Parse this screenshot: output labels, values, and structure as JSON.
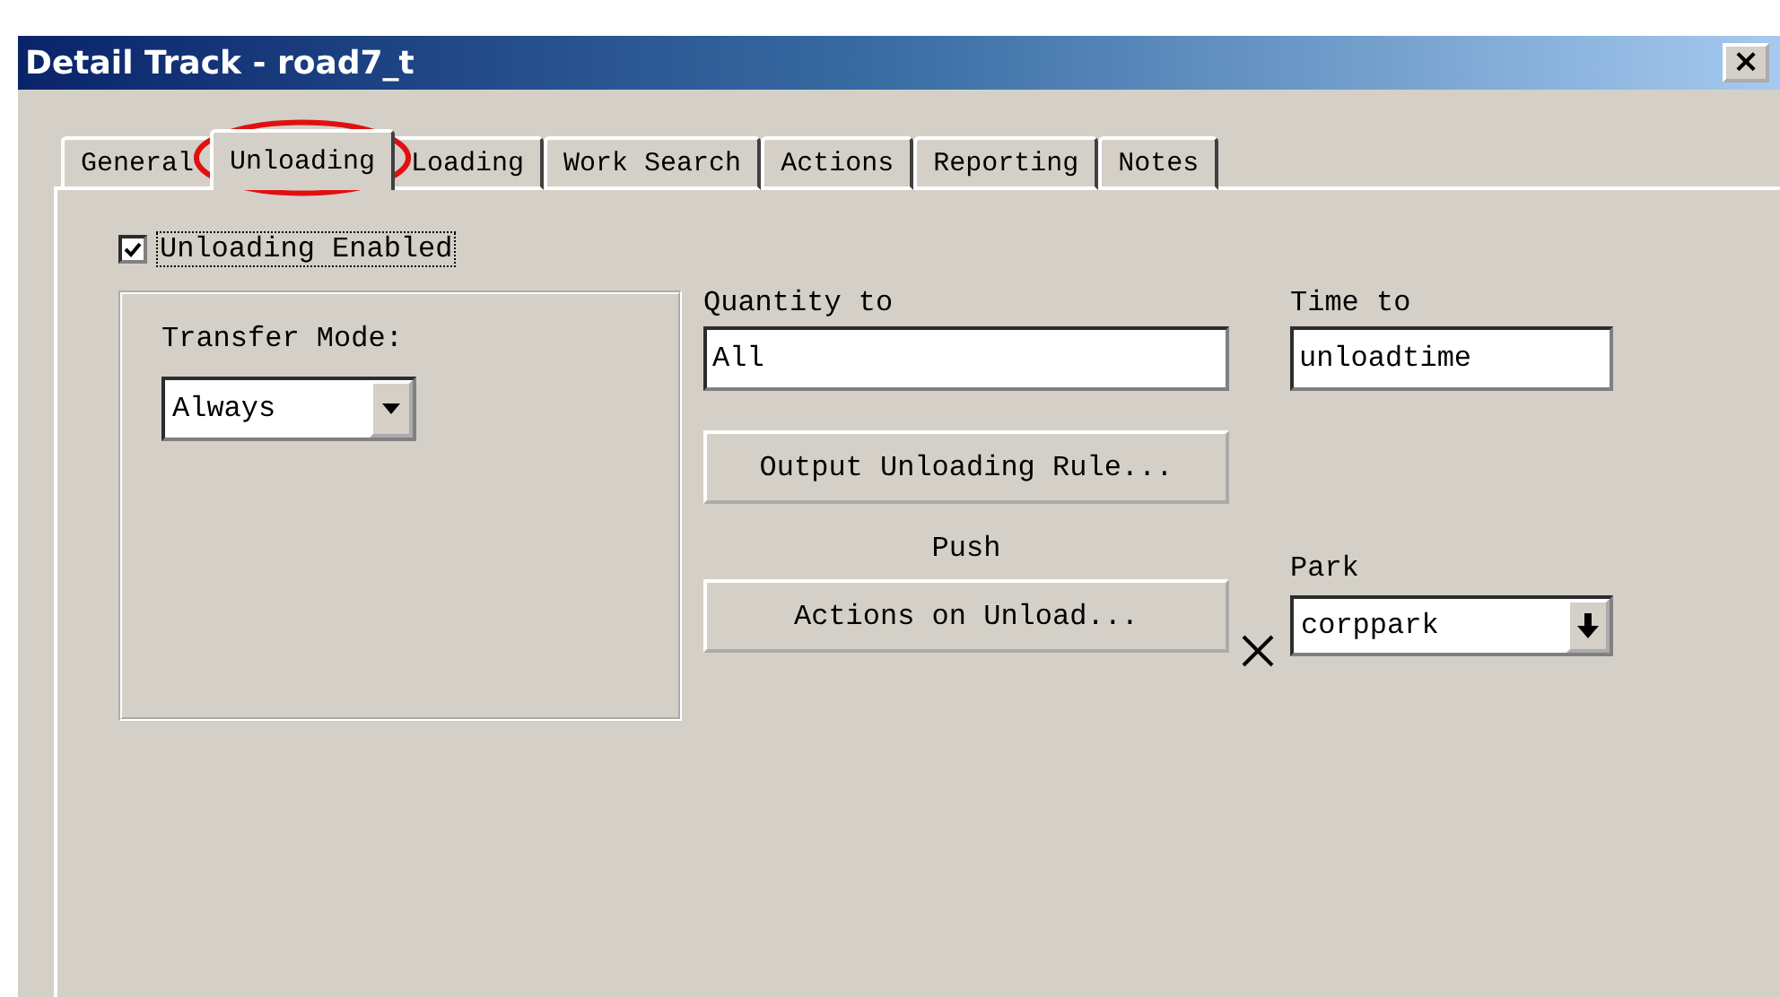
{
  "window": {
    "title": "Detail Track - road7_t",
    "close": "×"
  },
  "tabs": [
    {
      "label": "General",
      "selected": false
    },
    {
      "label": "Unloading",
      "selected": true,
      "circled": true
    },
    {
      "label": "Loading",
      "selected": false
    },
    {
      "label": "Work Search",
      "selected": false
    },
    {
      "label": "Actions",
      "selected": false
    },
    {
      "label": "Reporting",
      "selected": false
    },
    {
      "label": "Notes",
      "selected": false
    }
  ],
  "unloading_enabled": {
    "label": "Unloading Enabled",
    "checked": true
  },
  "transfer_mode": {
    "label": "Transfer Mode:",
    "value": "Always"
  },
  "quantity": {
    "label": "Quantity to",
    "value": "All"
  },
  "time": {
    "label": "Time to",
    "value": "unloadtime"
  },
  "output_button": "Output Unloading Rule...",
  "push_label": "Push",
  "actions_button": "Actions on Unload...",
  "park": {
    "label": "Park",
    "value": "corppark"
  }
}
